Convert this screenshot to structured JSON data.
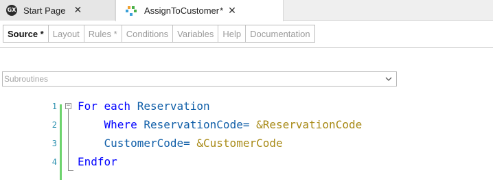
{
  "doc_tabs": [
    {
      "label": "Start Page",
      "close": "✕",
      "icon": "gx-logo-icon"
    },
    {
      "label": "AssignToCustomer",
      "modified": "*",
      "close": "✕",
      "icon": "procedure-object-icon"
    }
  ],
  "section_tabs": [
    {
      "label": "Source *",
      "active": true
    },
    {
      "label": "Layout"
    },
    {
      "label": "Rules *"
    },
    {
      "label": "Conditions"
    },
    {
      "label": "Variables"
    },
    {
      "label": "Help"
    },
    {
      "label": "Documentation"
    }
  ],
  "subroutines": {
    "value": "Subroutines",
    "icon": "chevron-down-icon"
  },
  "code": {
    "line_numbers": [
      "1",
      "2",
      "3",
      "4"
    ],
    "lines": [
      [
        {
          "t": "For each",
          "c": "kw"
        },
        {
          "t": " Reservation",
          "c": "id"
        }
      ],
      [
        {
          "t": "    Where",
          "c": "kw"
        },
        {
          "t": " ReservationCode= ",
          "c": "id"
        },
        {
          "t": "&ReservationCode",
          "c": "var"
        }
      ],
      [
        {
          "t": "    CustomerCode= ",
          "c": "id"
        },
        {
          "t": "&CustomerCode",
          "c": "var"
        }
      ],
      [
        {
          "t": "Endfor",
          "c": "kw"
        }
      ]
    ]
  },
  "colors": {
    "keyword": "#0000ff",
    "identifier": "#0f5ea8",
    "variable": "#a88a16",
    "change_bar": "#6ed36e"
  }
}
